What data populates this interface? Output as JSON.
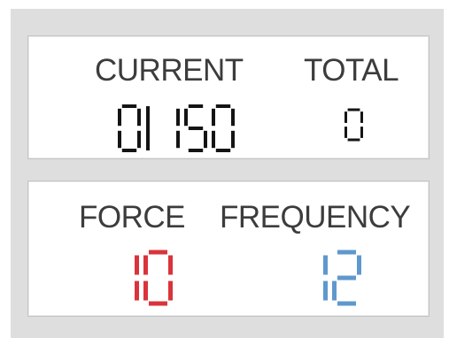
{
  "counter": {
    "current_label": "CURRENT",
    "current_value": "0|150",
    "total_label": "TOTAL",
    "total_value": "0"
  },
  "settings": {
    "force_label": "FORCE",
    "force_value": "10",
    "frequency_label": "FREQUENCY",
    "frequency_value": "12"
  },
  "colors": {
    "label": "#3c3c3c",
    "current_digits": "#141414",
    "total_digits": "#141414",
    "force_digits": "#d9343b",
    "frequency_digits": "#5f98cd",
    "background": "#dedede",
    "panel": "#ffffff"
  }
}
